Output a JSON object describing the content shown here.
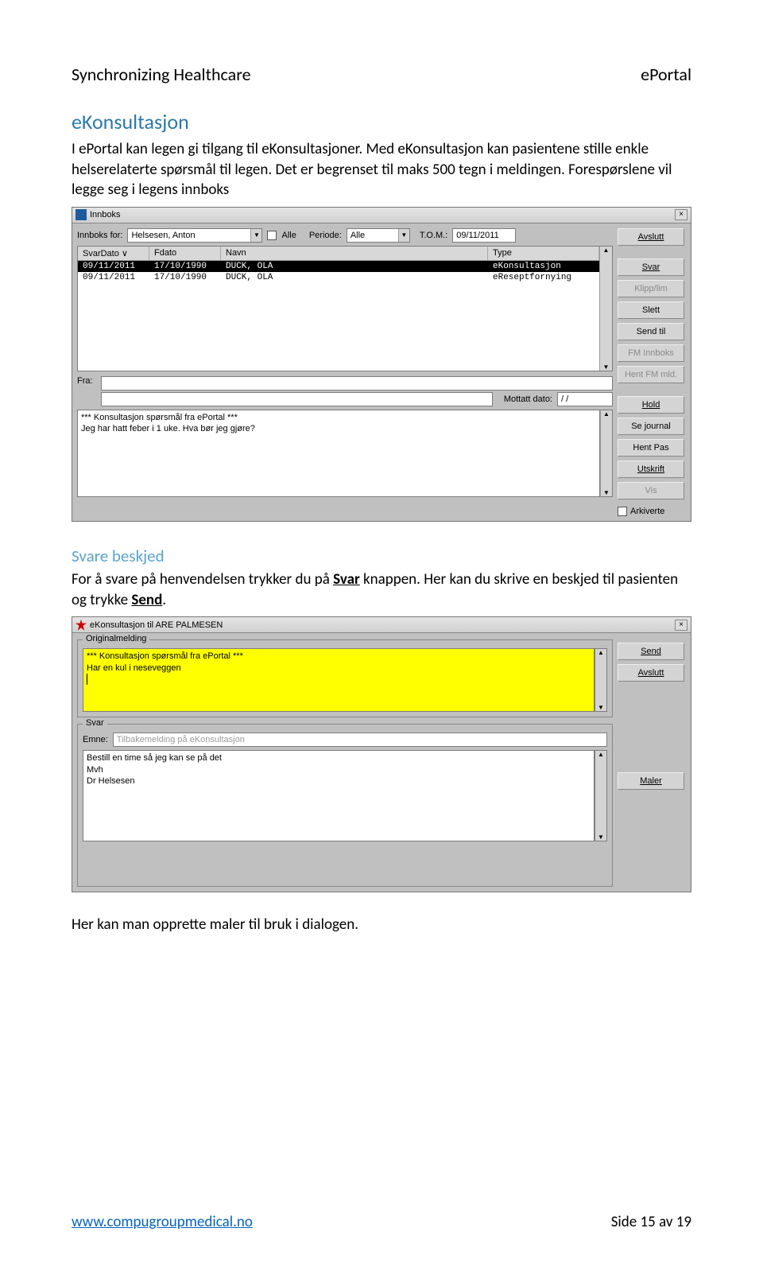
{
  "header": {
    "left": "Synchronizing Healthcare",
    "right": "ePortal"
  },
  "sec1": {
    "title": "eKonsultasjon",
    "p1": "I ePortal kan legen gi tilgang til eKonsultasjoner. Med eKonsultasjon kan pasientene stille enkle helserelaterte spørsmål til legen. Det er begrenset til maks 500 tegn i meldingen. Forespørslene vil legge seg i legens innboks"
  },
  "win1": {
    "title": "Innboks",
    "innboks_for_label": "Innboks for:",
    "innboks_for_value": "Helsesen, Anton",
    "alle_chk_label": "Alle",
    "periode_label": "Periode:",
    "periode_value": "Alle",
    "tom_label": "T.O.M.:",
    "tom_value": "09/11/2011",
    "cols": {
      "svar": "SvarDato ∨",
      "fdato": "Fdato",
      "navn": "Navn",
      "type": "Type"
    },
    "rows": [
      {
        "svar": "09/11/2011",
        "fdato": "17/10/1990",
        "navn": "DUCK, OLA",
        "type": "eKonsultasjon"
      },
      {
        "svar": "09/11/2011",
        "fdato": "17/10/1990",
        "navn": "DUCK, OLA",
        "type": "eReseptfornying"
      }
    ],
    "fra_label": "Fra:",
    "mottatt_label": "Mottatt dato:",
    "mottatt_value": "/  /",
    "msg_l1": "*** Konsultasjon spørsmål  fra ePortal ***",
    "msg_l2": "Jeg har hatt feber i 1 uke. Hva bør jeg gjøre?",
    "btn": {
      "avslutt": "Avslutt",
      "svar": "Svar",
      "klipp": "Klipp/lim",
      "slett": "Slett",
      "sendtil": "Send til",
      "fminn": "FM Innboks",
      "hentfm": "Hent FM mld.",
      "hold": "Hold",
      "sejournal": "Se journal",
      "hentpas": "Hent Pas",
      "utskrift": "Utskrift",
      "vis": "Vis",
      "arkiverte": "Arkiverte"
    }
  },
  "sec2": {
    "title": "Svare beskjed",
    "p_a": "For å svare på henvendelsen trykker du på ",
    "p_b": "Svar",
    "p_c": " knappen. Her kan du skrive en beskjed til pasienten og trykke ",
    "p_d": "Send",
    "p_e": "."
  },
  "win2": {
    "title": "eKonsultasjon til ARE PALMESEN",
    "orig_label": "Originalmelding",
    "orig_l1": "*** Konsultasjon spørsmål  fra ePortal ***",
    "orig_l2": "Har en kul i neseveggen",
    "svar_label": "Svar",
    "emne_label": "Emne:",
    "emne_value": "Tilbakemelding på eKonsultasjon",
    "body_l1": "Bestill en time så jeg kan se på det",
    "body_l2": "",
    "body_l3": "Mvh",
    "body_l4": "Dr Helsesen",
    "btn": {
      "send": "Send",
      "avslutt": "Avslutt",
      "maler": "Maler"
    }
  },
  "closing": "Her kan man opprette maler til bruk i dialogen.",
  "footer": {
    "url": "www.compugroupmedical.no",
    "page": "Side 15 av 19"
  }
}
